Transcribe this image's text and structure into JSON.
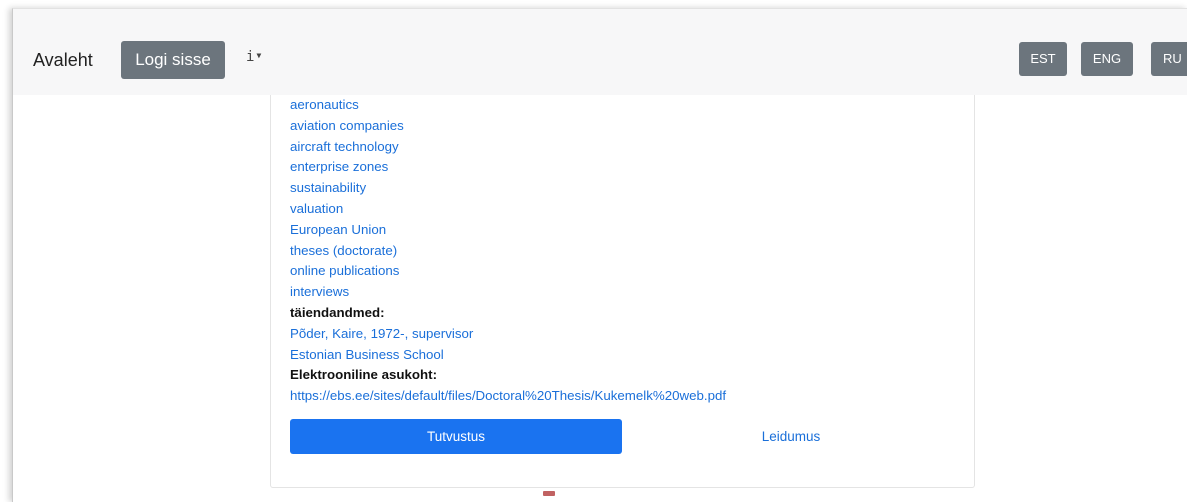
{
  "navbar": {
    "home_label": "Avaleht",
    "login_label": "Logi sisse",
    "info_icon_glyph": "i",
    "languages": [
      "EST",
      "ENG",
      "RU"
    ]
  },
  "record": {
    "subjects": [
      "aeronautics",
      "aviation companies",
      "aircraft technology",
      "enterprise zones",
      "sustainability",
      "valuation",
      "European Union",
      "theses (doctorate)",
      "online publications",
      "interviews"
    ],
    "additional_heading": "täiendandmed:",
    "additional": [
      "Põder, Kaire, 1972-, supervisor",
      "Estonian Business School"
    ],
    "location_heading": "Elektrooniline asukoht:",
    "location_url": "https://ebs.ee/sites/default/files/Doctoral%20Thesis/Kukemelk%20web.pdf"
  },
  "actions": {
    "primary_label": "Tutvustus",
    "secondary_label": "Leidumus"
  },
  "colors": {
    "link": "#1a6fd9",
    "primary": "#1a73f0",
    "nav_button": "#6c757d",
    "navbar_bg": "#f7f7f8"
  }
}
